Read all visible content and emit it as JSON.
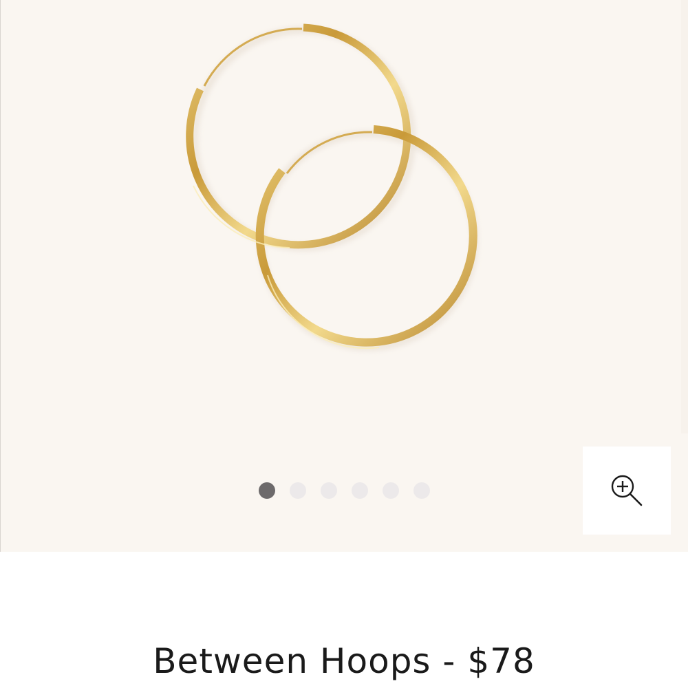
{
  "product": {
    "title": "Between Hoops - $78",
    "image": {
      "subject": "gold-hoop-earrings",
      "metal_color": "#c9a24a"
    }
  },
  "gallery": {
    "background": "#faf6f1",
    "image_count": 6,
    "active_index": 0,
    "zoom_icon": "zoom-in-icon"
  }
}
